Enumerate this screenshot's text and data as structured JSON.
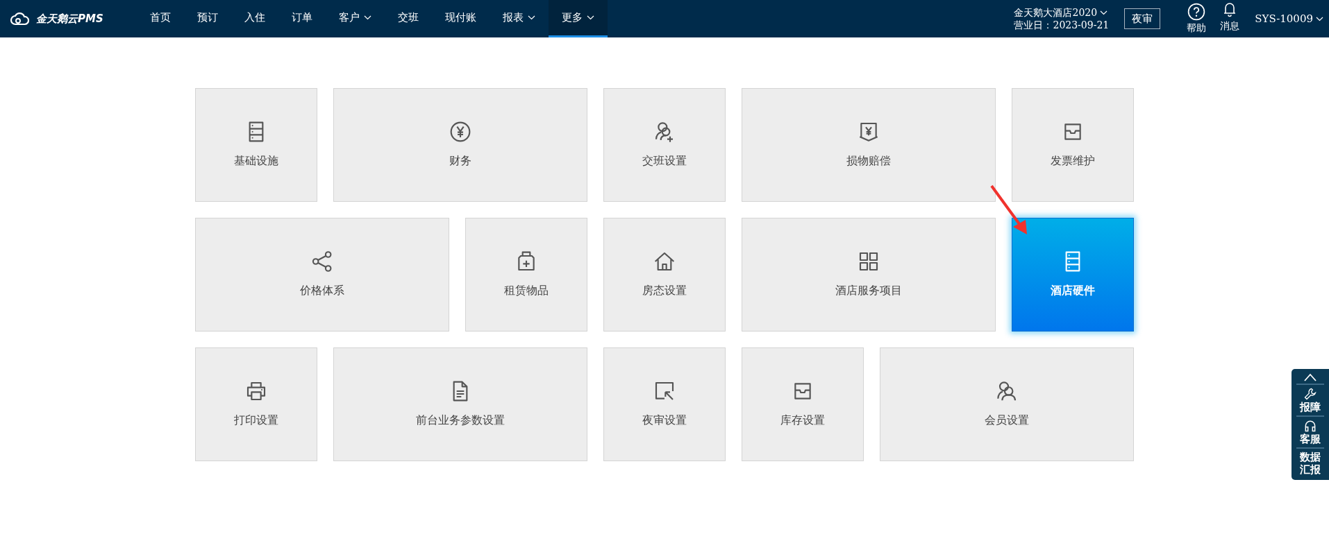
{
  "brand": "金天鹅云PMS",
  "nav": [
    {
      "label": "首页",
      "dropdown": false,
      "selected": false
    },
    {
      "label": "预订",
      "dropdown": false,
      "selected": false
    },
    {
      "label": "入住",
      "dropdown": false,
      "selected": false
    },
    {
      "label": "订单",
      "dropdown": false,
      "selected": false
    },
    {
      "label": "客户",
      "dropdown": true,
      "selected": false
    },
    {
      "label": "交班",
      "dropdown": false,
      "selected": false
    },
    {
      "label": "现付账",
      "dropdown": false,
      "selected": false
    },
    {
      "label": "报表",
      "dropdown": true,
      "selected": false
    },
    {
      "label": "更多",
      "dropdown": true,
      "selected": true
    }
  ],
  "hotel": {
    "name": "金天鹅大酒店2020",
    "business_date": "营业日：2023-09-21"
  },
  "night_audit_button": "夜审",
  "help": "帮助",
  "messages": "消息",
  "user": "SYS-10009",
  "tiles": [
    {
      "label": "基础设施",
      "wide": false,
      "selected": false
    },
    {
      "label": "财务",
      "wide": true,
      "selected": false
    },
    {
      "label": "交班设置",
      "wide": false,
      "selected": false
    },
    {
      "label": "损物赔偿",
      "wide": true,
      "selected": false
    },
    {
      "label": "发票维护",
      "wide": false,
      "selected": false
    },
    {
      "label": "价格体系",
      "wide": true,
      "selected": false
    },
    {
      "label": "租赁物品",
      "wide": false,
      "selected": false
    },
    {
      "label": "房态设置",
      "wide": false,
      "selected": false
    },
    {
      "label": "酒店服务项目",
      "wide": true,
      "selected": false
    },
    {
      "label": "酒店硬件",
      "wide": false,
      "selected": true
    },
    {
      "label": "打印设置",
      "wide": false,
      "selected": false
    },
    {
      "label": "前台业务参数设置",
      "wide": true,
      "selected": false
    },
    {
      "label": "夜审设置",
      "wide": false,
      "selected": false
    },
    {
      "label": "库存设置",
      "wide": false,
      "selected": false
    },
    {
      "label": "会员设置",
      "wide": true,
      "selected": false
    }
  ],
  "callout_arrow": true,
  "side_panel": {
    "items": [
      "报障",
      "客服",
      "数据汇报"
    ]
  }
}
